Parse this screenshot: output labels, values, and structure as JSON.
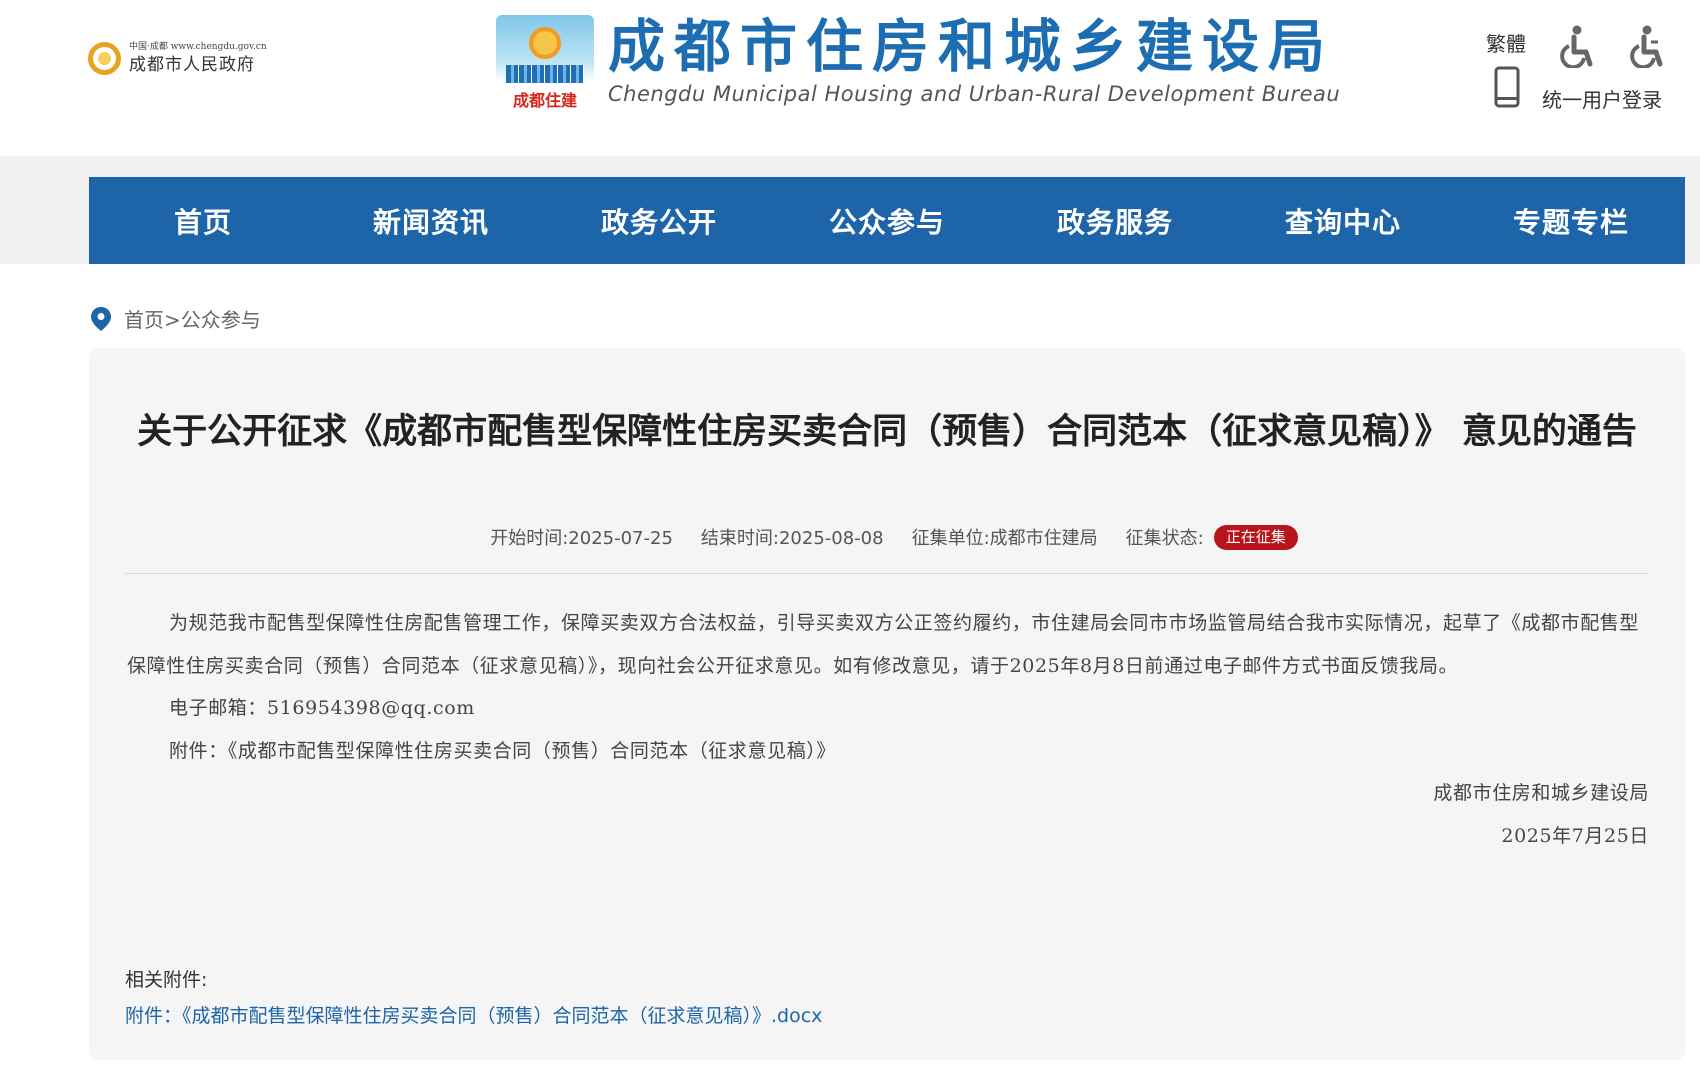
{
  "header": {
    "gov_small": "中国·成都 www.chengdu.gov.cn",
    "gov_name": "成都市人民政府",
    "bureau_logo_text": "成都住建",
    "title_cn": "成都市住房和城乡建设局",
    "title_en": "Chengdu Municipal Housing and Urban-Rural Development Bureau",
    "traditional": "繁體",
    "accessibility_icons": [
      "wheelchair-icon",
      "wheelchair-icon"
    ],
    "login": "统一用户登录",
    "brand_color": "#1d65a8",
    "title_color": "#1c6db2"
  },
  "nav": {
    "items": [
      "首页",
      "新闻资讯",
      "政务公开",
      "公众参与",
      "政务服务",
      "查询中心",
      "专题专栏"
    ]
  },
  "breadcrumb": {
    "home": "首页",
    "separator": ">",
    "current": "公众参与"
  },
  "article": {
    "title": "关于公开征求《成都市配售型保障性住房买卖合同（预售）合同范本（征求意见稿）》 意见的通告",
    "meta": {
      "start": "开始时间:2025-07-25",
      "end": "结束时间:2025-08-08",
      "unit": "征集单位:成都市住建局",
      "status_label": "征集状态:",
      "status_value": "正在征集",
      "status_color": "#b8141b"
    },
    "paragraph": "为规范我市配售型保障性住房配售管理工作，保障买卖双方合法权益，引导买卖双方公正签约履约，市住建局会同市市场监管局结合我市实际情况，起草了《成都市配售型保障性住房买卖合同（预售）合同范本（征求意见稿）》，现向社会公开征求意见。如有修改意见，请于2025年8月8日前通过电子邮件方式书面反馈我局。",
    "email_line": "电子邮箱：516954398@qq.com",
    "attachment_line": "附件：《成都市配售型保障性住房买卖合同（预售）合同范本（征求意见稿）》",
    "signature": "成都市住房和城乡建设局",
    "date": "2025年7月25日",
    "related_label": "相关附件:",
    "related_link": "附件：《成都市配售型保障性住房买卖合同（预售）合同范本（征求意见稿）》.docx"
  }
}
